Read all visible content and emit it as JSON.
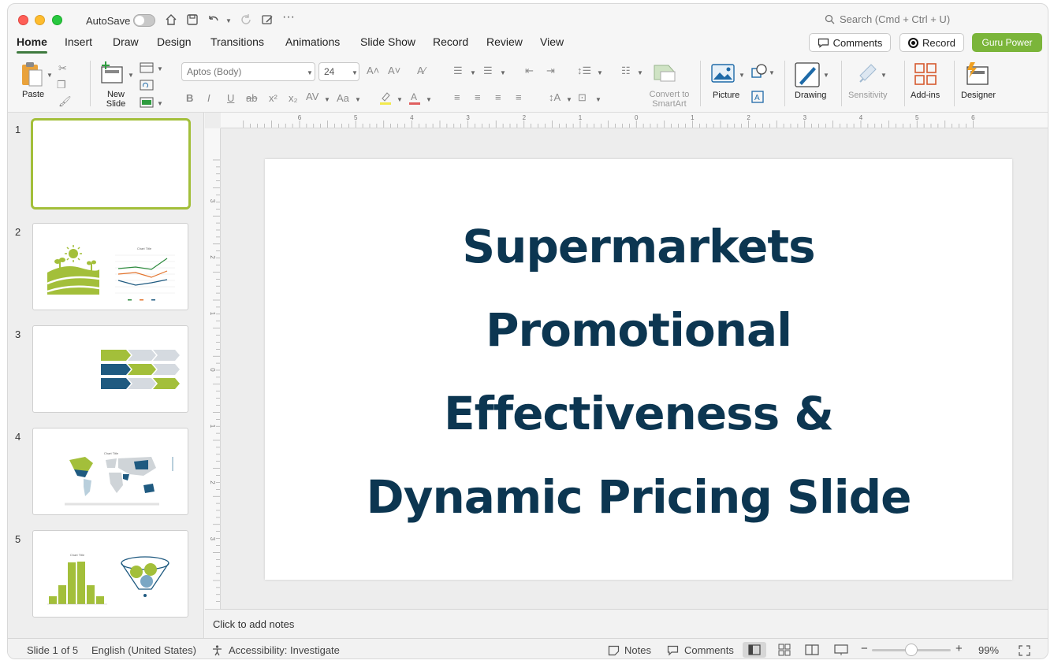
{
  "titlebar": {
    "autosave_label": "AutoSave",
    "search_placeholder": "Search (Cmd + Ctrl + U)"
  },
  "tabs": [
    "Home",
    "Insert",
    "Draw",
    "Design",
    "Transitions",
    "Animations",
    "Slide Show",
    "Record",
    "Review",
    "View"
  ],
  "header_buttons": {
    "comments": "Comments",
    "record": "Record",
    "guru": "Guru Power"
  },
  "ribbon": {
    "paste": "Paste",
    "new_slide": "New Slide",
    "font_name": "Aptos (Body)",
    "font_size": "24",
    "convert_smartart": "Convert to SmartArt",
    "picture": "Picture",
    "drawing": "Drawing",
    "sensitivity": "Sensitivity",
    "addins": "Add-ins",
    "designer": "Designer"
  },
  "slides": [
    {
      "number": "1"
    },
    {
      "number": "2",
      "thumb_title": "Chart Title"
    },
    {
      "number": "3"
    },
    {
      "number": "4",
      "thumb_title": "Chart Title"
    },
    {
      "number": "5",
      "thumb_title": "Chart Title"
    }
  ],
  "ruler": {
    "h_ticks": [
      "6",
      "5",
      "4",
      "3",
      "2",
      "1",
      "0",
      "1",
      "2",
      "3",
      "4",
      "5",
      "6"
    ],
    "v_ticks": [
      "3",
      "2",
      "1",
      "0",
      "1",
      "2",
      "3"
    ]
  },
  "slide": {
    "title_lines": [
      "Supermarkets",
      "Promotional",
      "Effectiveness &",
      "Dynamic Pricing Slide"
    ]
  },
  "notes": {
    "placeholder": "Click to add notes"
  },
  "status": {
    "slide_indicator": "Slide 1 of 5",
    "language": "English (United States)",
    "accessibility": "Accessibility: Investigate",
    "notes": "Notes",
    "comments": "Comments",
    "zoom": "99%"
  },
  "colors": {
    "title": "#0c3651",
    "accent_green": "#a3bf3a",
    "accent_blue": "#1f5a80",
    "guru_button": "#7bb53a"
  }
}
